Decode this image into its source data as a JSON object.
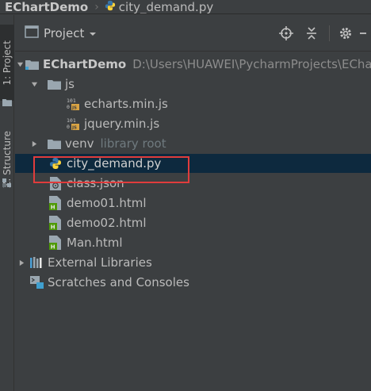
{
  "breadcrumb": {
    "project": "EChartDemo",
    "file": "city_demand.py"
  },
  "toolstrip": {
    "project_tab": "1: Project",
    "structure_tab": "Z: Structure"
  },
  "panel": {
    "view_label": "Project"
  },
  "tree": {
    "root": {
      "name": "EChartDemo",
      "path": "D:\\Users\\HUAWEI\\PycharmProjects\\EChart"
    },
    "js_folder": "js",
    "echarts": "echarts.min.js",
    "jquery": "jquery.min.js",
    "venv": "venv",
    "venv_note": "library root",
    "city_demand": "city_demand.py",
    "class_json": "class.json",
    "demo01": "demo01.html",
    "demo02": "demo02.html",
    "man": "Man.html",
    "external": "External Libraries",
    "scratches": "Scratches and Consoles"
  },
  "colors": {
    "background": "#3c3f41",
    "selection": "#0d293e",
    "highlight_box": "#e03c3c",
    "html_icon": "#4e9a06",
    "js_badge": "#d9a343",
    "python_blue": "#3776ab",
    "python_yellow": "#ffd43b"
  }
}
